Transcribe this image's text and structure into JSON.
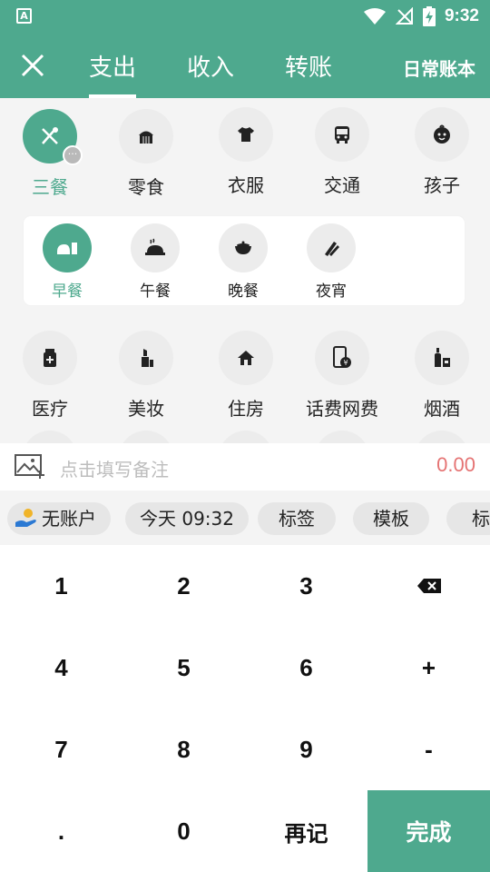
{
  "status_bar": {
    "time": "9:32",
    "app_badge": "A"
  },
  "header": {
    "tabs": [
      "支出",
      "收入",
      "转账"
    ],
    "active_tab": "支出",
    "book_name": "日常账本"
  },
  "categories": [
    {
      "label": "三餐",
      "icon": "utensils-icon",
      "active": true
    },
    {
      "label": "零食",
      "icon": "cake-icon"
    },
    {
      "label": "衣服",
      "icon": "shirt-icon"
    },
    {
      "label": "交通",
      "icon": "bus-icon"
    },
    {
      "label": "孩子",
      "icon": "baby-face-icon"
    },
    {
      "label": "医疗",
      "icon": "medicine-icon"
    },
    {
      "label": "美妆",
      "icon": "lipstick-icon"
    },
    {
      "label": "住房",
      "icon": "house-icon"
    },
    {
      "label": "话费网费",
      "icon": "phone-bill-icon"
    },
    {
      "label": "烟酒",
      "icon": "bottles-icon"
    }
  ],
  "subcategories": [
    {
      "label": "早餐",
      "icon": "breakfast-icon",
      "active": true
    },
    {
      "label": "午餐",
      "icon": "lunch-icon"
    },
    {
      "label": "晚餐",
      "icon": "dinner-bowl-icon"
    },
    {
      "label": "夜宵",
      "icon": "snack-icon"
    }
  ],
  "remark": {
    "placeholder": "点击填写备注",
    "amount": "0.00"
  },
  "chips": [
    {
      "label": "无账户",
      "icon": "wallet-hand-icon"
    },
    {
      "label": "今天 09:32"
    },
    {
      "label": "标签"
    },
    {
      "label": "模板"
    },
    {
      "label": "标"
    }
  ],
  "keypad": {
    "keys": [
      "1",
      "2",
      "3",
      "4",
      "5",
      "6",
      "+",
      "7",
      "8",
      "9",
      "-",
      ".",
      "0",
      "再记",
      "完成"
    ]
  },
  "colors": {
    "accent": "#4ea98e",
    "amount": "#e57373"
  }
}
